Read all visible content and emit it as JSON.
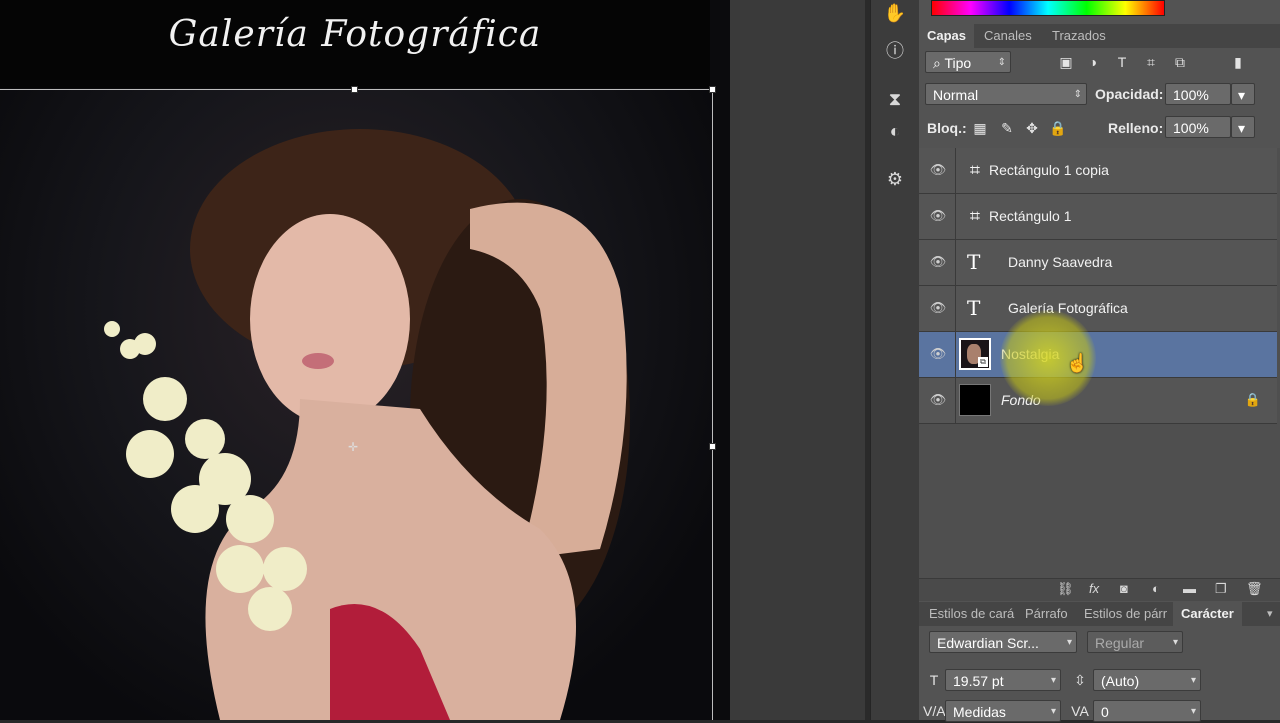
{
  "document": {
    "title": "Galería Fotográfica"
  },
  "layers_panel": {
    "tabs": [
      {
        "label": "Capas",
        "active": true
      },
      {
        "label": "Canales",
        "active": false
      },
      {
        "label": "Trazados",
        "active": false
      }
    ],
    "filter": {
      "kind": "Tipo"
    },
    "blend_mode": "Normal",
    "opacity_label": "Opacidad:",
    "opacity_value": "100%",
    "lock_label": "Bloq.:",
    "fill_label": "Relleno:",
    "fill_value": "100%",
    "layers": [
      {
        "name": "Rectángulo 1 copia",
        "type": "shape",
        "selected": false
      },
      {
        "name": "Rectángulo 1",
        "type": "shape",
        "selected": false
      },
      {
        "name": "Danny Saavedra",
        "type": "text",
        "selected": false
      },
      {
        "name": "Galería Fotográfica",
        "type": "text",
        "selected": false
      },
      {
        "name": "Nostalgia",
        "type": "smart-object",
        "selected": true
      },
      {
        "name": "Fondo",
        "type": "background",
        "selected": false,
        "locked": true
      }
    ]
  },
  "character_panel": {
    "tabs": [
      {
        "label": "Estilos de cará",
        "active": false
      },
      {
        "label": "Párrafo",
        "active": false
      },
      {
        "label": "Estilos de párr",
        "active": false
      },
      {
        "label": "Carácter",
        "active": true
      }
    ],
    "font_family": "Edwardian Scr...",
    "font_style": "Regular",
    "font_size": "19.57 pt",
    "leading": "(Auto)",
    "kerning": "Medidas",
    "tracking": "0"
  },
  "colors": {
    "selected_layer": "#5a74a0",
    "panel_bg": "#535353",
    "highlight": "#d7d71e"
  }
}
